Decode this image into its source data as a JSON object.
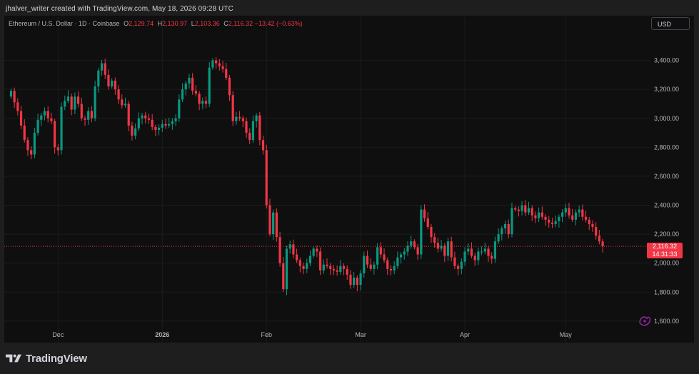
{
  "header": {
    "credit": "jhalver_writer created with TradingView.com, May 18, 2026 09:28 UTC"
  },
  "legend": {
    "symbol": "Ethereum / U.S. Dollar · 1D · Coinbase",
    "o_label": "O",
    "o_value": "2,129.74",
    "h_label": "H",
    "h_value": "2,130.97",
    "l_label": "L",
    "l_value": "2,103.36",
    "c_label": "C",
    "c_value": "2,116.32",
    "change": "−13.42 (−0.63%)"
  },
  "currency_button": "USD",
  "last_price": {
    "price": "2,116.32",
    "countdown": "14:31:33"
  },
  "brand": {
    "name": "TradingView"
  },
  "colors": {
    "up": "#089981",
    "down": "#f23645",
    "background": "#0f0f0f",
    "grid": "#1c1c1c",
    "text": "#b2b5be",
    "price_line": "#f23645",
    "floating_icon": "#9c27b0"
  },
  "icons": [
    "tradingview-logo-icon",
    "floating-assistant-icon"
  ],
  "chart_data": {
    "type": "candlestick",
    "interval": "1D",
    "x_axis_labels": [
      "Dec",
      "2026",
      "Feb",
      "Mar",
      "Apr",
      "May"
    ],
    "y_axis_labels": [
      "3,400.00",
      "3,200.00",
      "3,000.00",
      "2,800.00",
      "2,600.00",
      "2,400.00",
      "2,200.00",
      "2,000.00",
      "1,800.00",
      "1,600.00"
    ],
    "ylim": [
      1550,
      3600
    ],
    "grid": true,
    "x_range": [
      "2025-11-15",
      "2026-05-26"
    ],
    "last_close": 2116.32,
    "close_series": {
      "start_date": "2025-11-17",
      "closes": [
        3190,
        3110,
        3050,
        2950,
        2850,
        2780,
        2750,
        2900,
        2990,
        3020,
        3050,
        3000,
        2980,
        2800,
        2780,
        3080,
        3120,
        3150,
        3060,
        3150,
        3100,
        3000,
        2990,
        3050,
        3000,
        3220,
        3330,
        3380,
        3300,
        3220,
        3260,
        3200,
        3130,
        3090,
        3100,
        2950,
        2880,
        2930,
        3000,
        3020,
        3000,
        2990,
        2940,
        2920,
        2935,
        2960,
        2950,
        2960,
        2980,
        3000,
        3130,
        3200,
        3240,
        3280,
        3190,
        3170,
        3100,
        3120,
        3100,
        3350,
        3400,
        3380,
        3360,
        3340,
        3280,
        3160,
        2980,
        3010,
        3000,
        2980,
        2900,
        2850,
        2980,
        3020,
        2850,
        2780,
        2400,
        2200,
        2350,
        2180,
        2000,
        1820,
        2100,
        2130,
        2060,
        2020,
        1980,
        1960,
        2000,
        2050,
        2100,
        2080,
        1950,
        1990,
        1980,
        1960,
        1950,
        1940,
        1980,
        1960,
        1920,
        1850,
        1900,
        1850,
        1930,
        2050,
        1990,
        1960,
        1990,
        2110,
        2060,
        2020,
        1960,
        1950,
        1980,
        2040,
        2060,
        2080,
        2120,
        2150,
        2110,
        2060,
        2370,
        2310,
        2250,
        2180,
        2140,
        2100,
        2120,
        2050,
        2150,
        2040,
        1980,
        1960,
        2010,
        2080,
        2100,
        2050,
        2020,
        2080,
        2080,
        2100,
        2050,
        2030,
        2150,
        2200,
        2240,
        2270,
        2200,
        2380,
        2370,
        2360,
        2400,
        2350,
        2380,
        2330,
        2310,
        2350,
        2320,
        2300,
        2280,
        2270,
        2290,
        2320,
        2350,
        2380,
        2330,
        2300,
        2350,
        2370,
        2320,
        2300,
        2270,
        2250,
        2190,
        2150,
        2116.32
      ]
    }
  }
}
